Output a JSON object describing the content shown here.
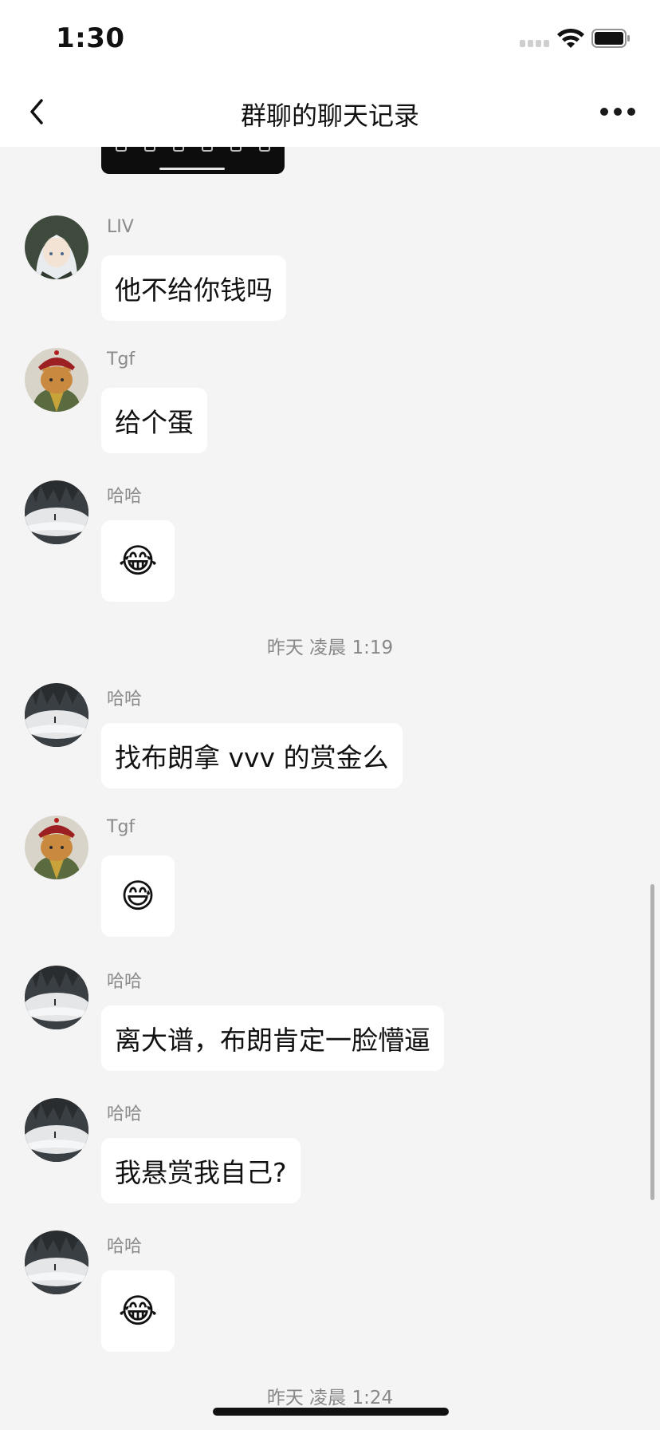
{
  "status_bar": {
    "time": "1:30"
  },
  "nav": {
    "title": "群聊的聊天记录"
  },
  "messages": [
    {
      "sender": "LIV",
      "text": "他不给你钱吗"
    },
    {
      "sender": "Tgf",
      "text": "给个蛋"
    },
    {
      "sender": "哈哈",
      "text": "😂"
    },
    {
      "sender": "哈哈",
      "text": "找布朗拿 vvv 的赏金么"
    },
    {
      "sender": "Tgf",
      "text": "😅"
    },
    {
      "sender": "哈哈",
      "text": "离大谱，布朗肯定一脸懵逼"
    },
    {
      "sender": "哈哈",
      "text": "我悬赏我自己?"
    },
    {
      "sender": "哈哈",
      "text": "😂"
    }
  ],
  "timestamps": [
    "昨天 凌晨 1:19",
    "昨天 凌晨 1:24"
  ],
  "icons": {
    "back": "chevron-left-icon",
    "more": "more-dots-icon",
    "wifi": "wifi-icon",
    "battery": "battery-icon",
    "signal": "signal-icon"
  },
  "colors": {
    "background": "#f4f4f4",
    "bubble": "#ffffff",
    "sender_text": "#8a8a8a"
  }
}
